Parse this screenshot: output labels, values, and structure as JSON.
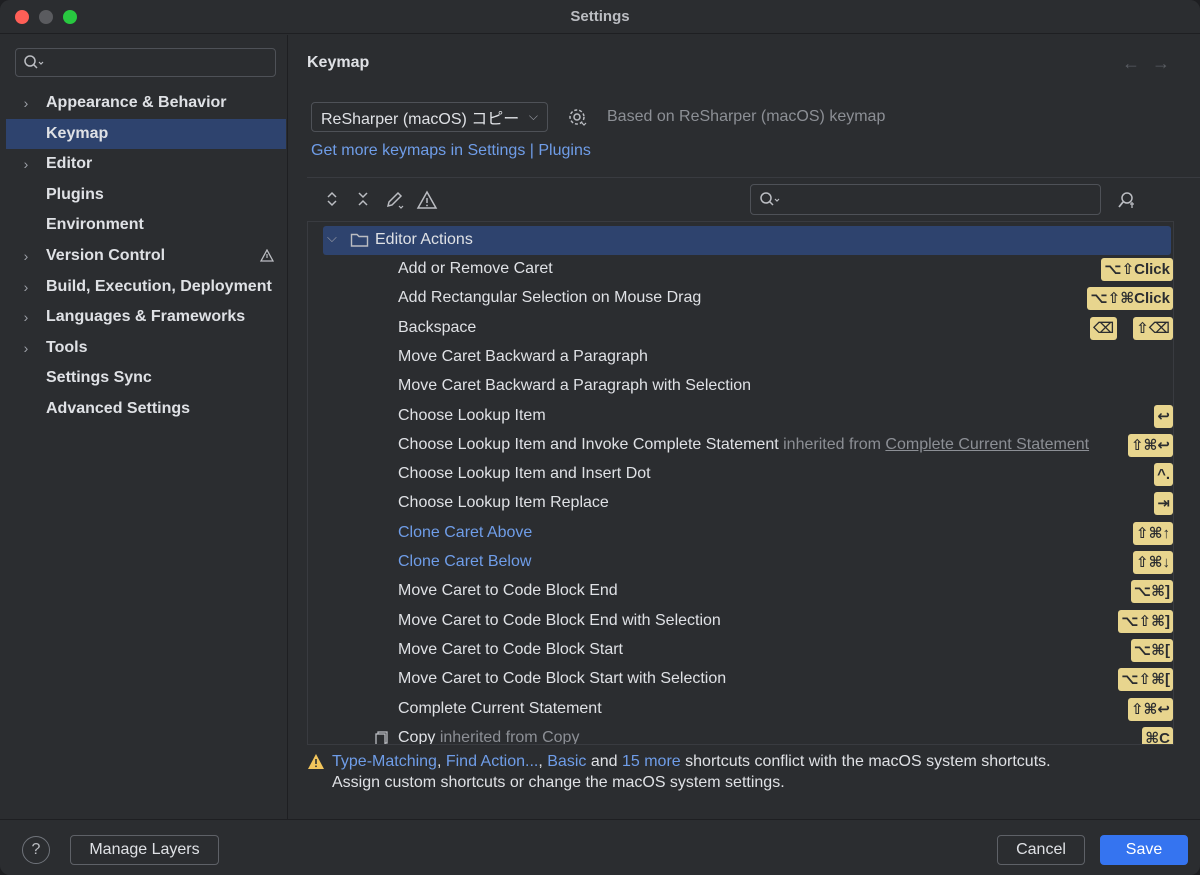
{
  "window": {
    "title": "Settings"
  },
  "sidebar": {
    "items": [
      {
        "label": "Appearance & Behavior",
        "expandable": true,
        "selected": false
      },
      {
        "label": "Keymap",
        "expandable": false,
        "selected": true
      },
      {
        "label": "Editor",
        "expandable": true,
        "selected": false
      },
      {
        "label": "Plugins",
        "expandable": false,
        "selected": false
      },
      {
        "label": "Environment",
        "expandable": false,
        "selected": false
      },
      {
        "label": "Version Control",
        "expandable": true,
        "selected": false,
        "icon": "vcs-warning-icon"
      },
      {
        "label": "Build, Execution, Deployment",
        "expandable": true,
        "selected": false
      },
      {
        "label": "Languages & Frameworks",
        "expandable": true,
        "selected": false
      },
      {
        "label": "Tools",
        "expandable": true,
        "selected": false
      },
      {
        "label": "Settings Sync",
        "expandable": false,
        "selected": false
      },
      {
        "label": "Advanced Settings",
        "expandable": false,
        "selected": false
      }
    ]
  },
  "main": {
    "heading": "Keymap",
    "keymap_select": "ReSharper (macOS) コピー",
    "based_on": "Based on ReSharper (macOS) keymap",
    "more_link_a": "Get more keymaps in Settings",
    "more_link_sep": "|",
    "more_link_b": "Plugins"
  },
  "tree": {
    "group": "Editor Actions",
    "rows": [
      {
        "label": "Add or Remove Caret",
        "keys": [
          "⌥⇧Click"
        ]
      },
      {
        "label": "Add Rectangular Selection on Mouse Drag",
        "keys": [
          "⌥⇧⌘Click"
        ]
      },
      {
        "label": "Backspace",
        "keys": [
          "⌫",
          "⇧⌫"
        ]
      },
      {
        "label": "Move Caret Backward a Paragraph",
        "keys": []
      },
      {
        "label": "Move Caret Backward a Paragraph with Selection",
        "keys": []
      },
      {
        "label": "Choose Lookup Item",
        "keys": [
          "↩"
        ]
      },
      {
        "label": "Choose Lookup Item and Invoke Complete Statement",
        "inherited_prefix": "inherited from",
        "inherited_link": "Complete Current Statement",
        "keys": [
          "⇧⌘↩"
        ]
      },
      {
        "label": "Choose Lookup Item and Insert Dot",
        "keys": [
          "^."
        ]
      },
      {
        "label": "Choose Lookup Item Replace",
        "keys": [
          "⇥"
        ]
      },
      {
        "label": "Clone Caret Above",
        "blue": true,
        "keys": [
          "⇧⌘↑"
        ]
      },
      {
        "label": "Clone Caret Below",
        "blue": true,
        "keys": [
          "⇧⌘↓"
        ]
      },
      {
        "label": "Move Caret to Code Block End",
        "keys": [
          "⌥⌘]"
        ]
      },
      {
        "label": "Move Caret to Code Block End with Selection",
        "keys": [
          "⌥⇧⌘]"
        ]
      },
      {
        "label": "Move Caret to Code Block Start",
        "keys": [
          "⌥⌘["
        ]
      },
      {
        "label": "Move Caret to Code Block Start with Selection",
        "keys": [
          "⌥⇧⌘["
        ]
      },
      {
        "label": "Complete Current Statement",
        "keys": [
          "⇧⌘↩"
        ]
      },
      {
        "label": "Copy",
        "inherited_prefix": "inherited from",
        "inherited_text": "Copy",
        "icon": "copy-icon",
        "keys": [
          "⌘C"
        ]
      }
    ]
  },
  "warning": {
    "link1": "Type-Matching",
    "sep1": ",",
    "link2": "Find Action...",
    "sep2": ",",
    "link3": "Basic",
    "and_text": "and",
    "link4": "15 more",
    "tail": "shortcuts conflict with the macOS system shortcuts.",
    "line2": "Assign custom shortcuts or change the macOS system settings."
  },
  "footer": {
    "help": "?",
    "manage_layers": "Manage Layers",
    "cancel": "Cancel",
    "save": "Save"
  },
  "colors": {
    "accent": "#3574f0",
    "selection": "#2e436e",
    "link": "#6f9de8",
    "shortcut_badge": "#e8d58e",
    "warning": "#f2c55c"
  }
}
